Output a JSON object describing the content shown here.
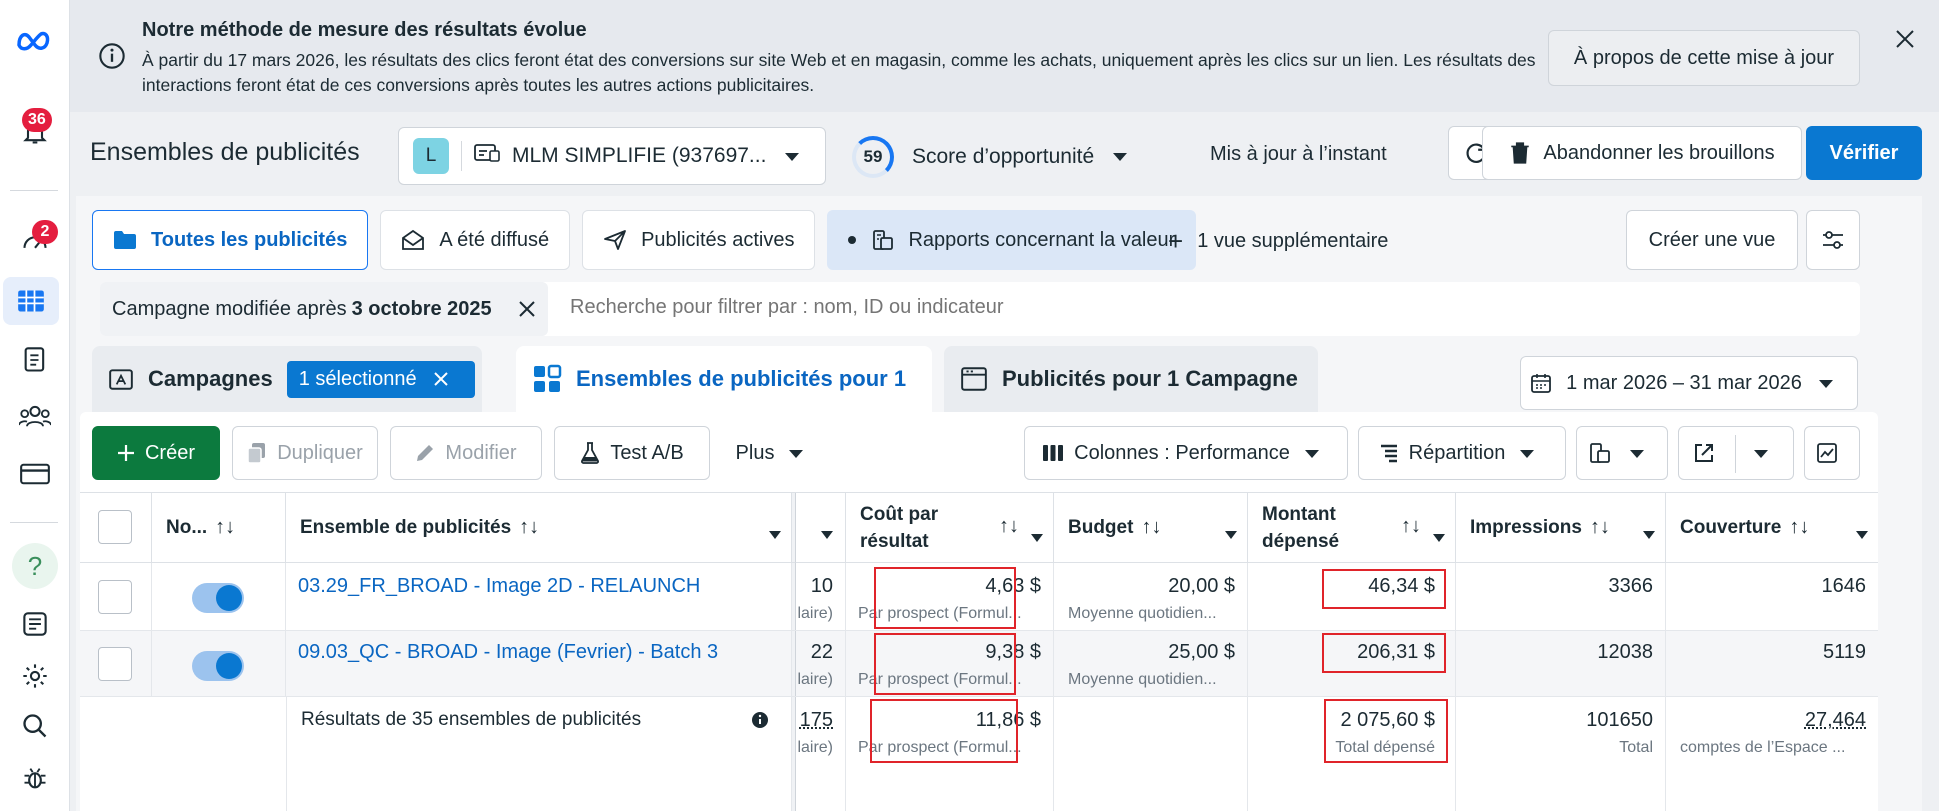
{
  "rail": {
    "notification_badge": "36",
    "alerts_badge": "2",
    "help_glyph": "?"
  },
  "banner": {
    "title": "Notre méthode de mesure des résultats évolue",
    "text": "À partir du 17 mars 2026, les résultats des clics feront état des conversions sur site Web et en magasin, comme les achats, uniquement après les clics sur un lien. Les résultats des interactions feront état de ces conversions après toutes les autres actions publicitaires.",
    "about_button": "À propos de cette mise à jour"
  },
  "header": {
    "page_title": "Ensembles de publicités",
    "account_initial": "L",
    "account_name": "MLM SIMPLIFIE (937697...",
    "score_value": "59",
    "score_label": "Score d’opportunité",
    "updated_text": "Mis à jour à l’instant",
    "discard_label": "Abandonner les brouillons",
    "verify_label": "Vérifier"
  },
  "views": {
    "all_ads": "Toutes les publicités",
    "delivered": "A été diffusé",
    "active_ads": "Publicités actives",
    "value_reports": "Rapports concernant la valeur",
    "more_view": "1 vue supplémentaire",
    "create_view": "Créer une vue"
  },
  "filter": {
    "chip_prefix": "Campagne modifiée après",
    "chip_value": "3 octobre 2025",
    "search_placeholder": "Recherche pour filtrer par : nom, ID ou indicateur"
  },
  "level_tabs": {
    "campaigns": "Campagnes",
    "selected_pill": "1 sélectionné",
    "adsets": "Ensembles de publicités pour 1",
    "ads": "Publicités pour 1 Campagne"
  },
  "date_range": "1 mar 2026 – 31 mar 2026",
  "toolbar": {
    "create": "Créer",
    "duplicate": "Dupliquer",
    "edit": "Modifier",
    "ab_test": "Test A/B",
    "more": "Plus",
    "columns": "Colonnes : Performance",
    "breakdown": "Répartition"
  },
  "table": {
    "headers": {
      "name_short": "No...",
      "adset": "Ensemble de publicités",
      "cost_per_result_l1": "Coût par",
      "cost_per_result_l2": "résultat",
      "budget": "Budget",
      "spent_l1": "Montant",
      "spent_l2": "dépensé",
      "impressions": "Impressions",
      "reach": "Couverture"
    },
    "rows": [
      {
        "name": "03.29_FR_BROAD - Image 2D - RELAUNCH",
        "results_partial": "10",
        "results_sub": "laire)",
        "cost": "4,63 $",
        "cost_sub": "Par prospect (Formul...",
        "budget": "20,00 $",
        "budget_sub": "Moyenne quotidien...",
        "spent": "46,34 $",
        "impressions": "3366",
        "reach": "1646"
      },
      {
        "name": "09.03_QC - BROAD - Image (Fevrier) - Batch 3",
        "results_partial": "22",
        "results_sub": "laire)",
        "cost": "9,38 $",
        "cost_sub": "Par prospect (Formul...",
        "budget": "25,00 $",
        "budget_sub": "Moyenne quotidien...",
        "spent": "206,31 $",
        "impressions": "12038",
        "reach": "5119"
      }
    ],
    "summary": {
      "label": "Résultats de 35 ensembles de publicités",
      "results_partial": "175",
      "results_sub": "laire)",
      "cost": "11,86 $",
      "cost_sub": "Par prospect (Formul...",
      "spent": "2 075,60 $",
      "spent_sub": "Total dépensé",
      "impressions": "101650",
      "impressions_sub": "Total",
      "reach": "27,464",
      "reach_sub": "comptes de l’Espace ..."
    }
  },
  "colors": {
    "primary_blue": "#0a78d1",
    "create_green": "#0c7a3e",
    "highlight_red": "#e0242a",
    "badge_red": "#e41e3f"
  }
}
